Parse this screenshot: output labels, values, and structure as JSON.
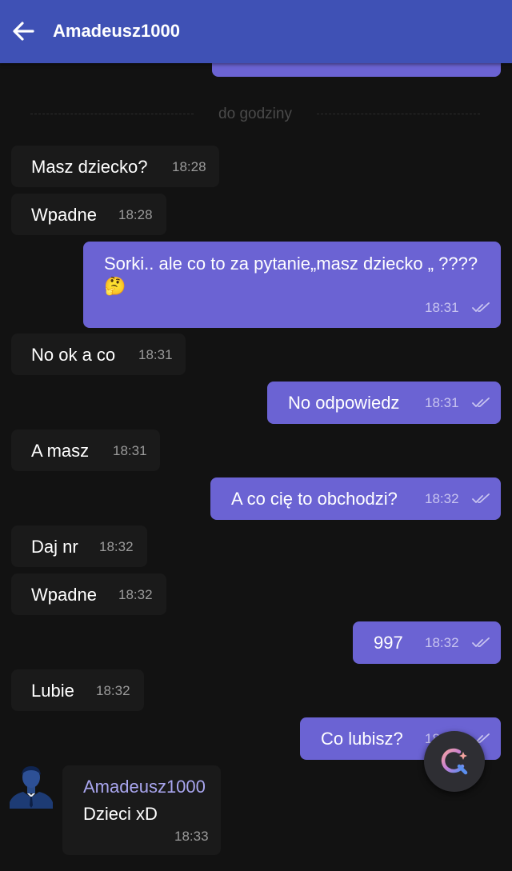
{
  "header": {
    "title": "Amadeusz1000",
    "back_icon": "arrow-left-icon"
  },
  "separator": {
    "label": "do godziny"
  },
  "messages": [
    {
      "dir": "in",
      "text": "Masz dziecko?",
      "time": "18:28"
    },
    {
      "dir": "in",
      "text": "Wpadne",
      "time": "18:28"
    },
    {
      "dir": "out",
      "text": "Sorki.. ale co to za pytanie„masz dziecko „ ????",
      "emoji": "🤔",
      "time": "18:31",
      "status": "read"
    },
    {
      "dir": "in",
      "text": "No ok a co",
      "time": "18:31"
    },
    {
      "dir": "out",
      "text": "No odpowiedz",
      "time": "18:31",
      "status": "read"
    },
    {
      "dir": "in",
      "text": "A masz",
      "time": "18:31"
    },
    {
      "dir": "out",
      "text": "A co cię to obchodzi?",
      "time": "18:32",
      "status": "read"
    },
    {
      "dir": "in",
      "text": "Daj nr",
      "time": "18:32"
    },
    {
      "dir": "in",
      "text": "Wpadne",
      "time": "18:32"
    },
    {
      "dir": "out",
      "text": "997",
      "time": "18:32",
      "status": "read"
    },
    {
      "dir": "in",
      "text": "Lubie",
      "time": "18:32"
    },
    {
      "dir": "out",
      "text": "Co lubisz?",
      "time": "18:32",
      "status": "read"
    },
    {
      "dir": "in",
      "sender": "Amadeusz1000",
      "text": "Dzieci xD",
      "time": "18:33"
    }
  ],
  "fab": {
    "icon": "assistant-search-icon"
  },
  "colors": {
    "header": "#3f51b5",
    "outgoing": "#6b63d3",
    "incoming": "#1a1a1a",
    "background": "#121212",
    "sender": "#a9a6ef"
  }
}
